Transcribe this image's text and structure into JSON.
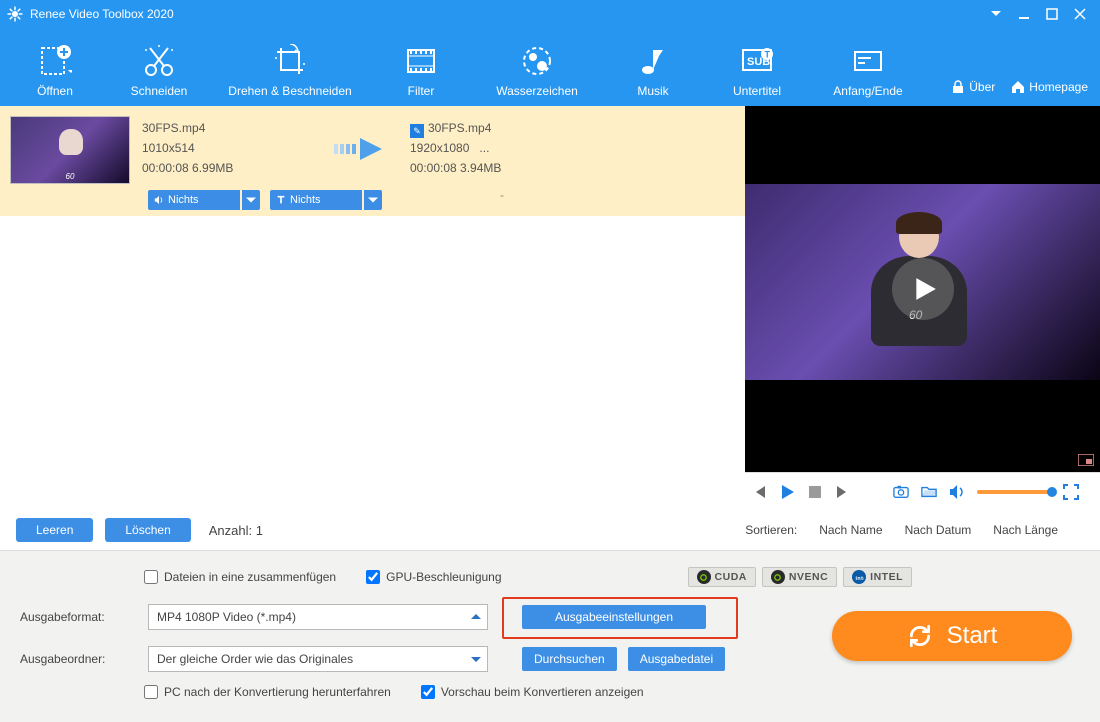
{
  "app": {
    "title": "Renee Video Toolbox 2020"
  },
  "toolbar": {
    "open": "Öffnen",
    "cut": "Schneiden",
    "rotate": "Drehen & Beschneiden",
    "filter": "Filter",
    "watermark": "Wasserzeichen",
    "music": "Musik",
    "subtitle": "Untertitel",
    "trim": "Anfang/Ende",
    "about": "Über",
    "home": "Homepage"
  },
  "file": {
    "src": {
      "name": "30FPS.mp4",
      "res": "1010x514",
      "meta": "00:00:08  6.99MB"
    },
    "dst": {
      "name": "30FPS.mp4",
      "res": "1920x1080",
      "dots": "...",
      "meta": "00:00:08  3.94MB"
    },
    "dd_audio": "Nichts",
    "dd_text": "Nichts",
    "dash": "-",
    "thumb_mark": "60"
  },
  "list": {
    "empty_btn": "Leeren",
    "delete_btn": "Löschen",
    "count_label": "Anzahl: 1",
    "sort_label": "Sortieren:",
    "sort_name": "Nach Name",
    "sort_date": "Nach Datum",
    "sort_len": "Nach Länge"
  },
  "preview": {
    "mark": "60"
  },
  "settings": {
    "merge": "Dateien in eine zusammenfügen",
    "gpu": "GPU-Beschleunigung",
    "badges": {
      "cuda": "CUDA",
      "nvenc": "NVENC",
      "intel": "INTEL"
    },
    "fmt_label": "Ausgabeformat:",
    "fmt_value": "MP4 1080P Video (*.mp4)",
    "out_settings": "Ausgabeeinstellungen",
    "dir_label": "Ausgabeordner:",
    "dir_value": "Der gleiche Order wie das Originales",
    "browse": "Durchsuchen",
    "outfile": "Ausgabedatei",
    "shutdown": "PC nach der Konvertierung herunterfahren",
    "preview_cbx": "Vorschau beim Konvertieren anzeigen",
    "start": "Start"
  }
}
